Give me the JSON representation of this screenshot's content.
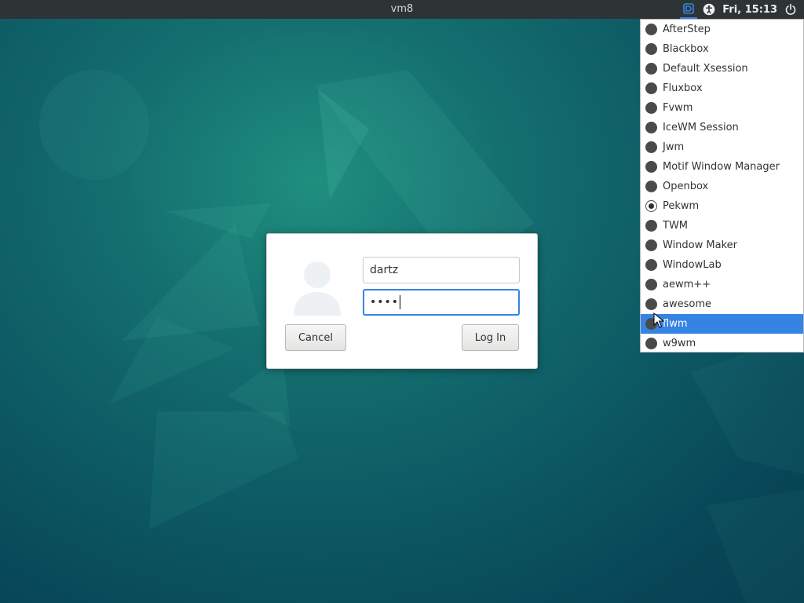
{
  "topbar": {
    "hostname": "vm8",
    "clock": "Fri, 15:13",
    "icons": [
      "session-icon",
      "accessibility-icon",
      "power-icon"
    ]
  },
  "login": {
    "username": "dartz",
    "password_mask": "••••",
    "cancel_label": "Cancel",
    "login_label": "Log In",
    "avatar_icon": "user-avatar-icon"
  },
  "session_menu": {
    "selected": "Pekwm",
    "highlighted": "flwm",
    "items": [
      {
        "label": "AfterStep",
        "checked": false
      },
      {
        "label": "Blackbox",
        "checked": false
      },
      {
        "label": "Default Xsession",
        "checked": false
      },
      {
        "label": "Fluxbox",
        "checked": false
      },
      {
        "label": "Fvwm",
        "checked": false
      },
      {
        "label": "IceWM Session",
        "checked": false
      },
      {
        "label": "Jwm",
        "checked": false
      },
      {
        "label": "Motif Window Manager",
        "checked": false
      },
      {
        "label": "Openbox",
        "checked": false
      },
      {
        "label": "Pekwm",
        "checked": true
      },
      {
        "label": "TWM",
        "checked": false
      },
      {
        "label": "Window Maker",
        "checked": false
      },
      {
        "label": "WindowLab",
        "checked": false
      },
      {
        "label": "aewm++",
        "checked": false
      },
      {
        "label": "awesome",
        "checked": false
      },
      {
        "label": "flwm",
        "checked": false
      },
      {
        "label": "w9wm",
        "checked": false
      }
    ]
  },
  "colors": {
    "accent": "#3584e4",
    "topbar": "#2e3436",
    "wallpaper_dark": "#084858",
    "wallpaper_light": "#1f8f7f"
  }
}
